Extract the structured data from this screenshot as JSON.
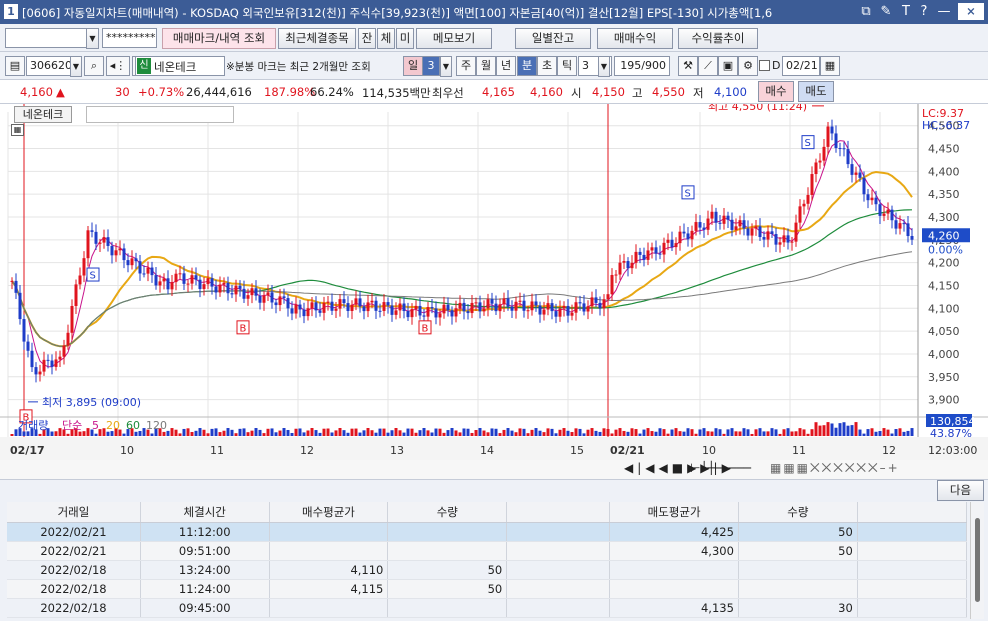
{
  "titlebar": {
    "num": "1",
    "title": "[0606] 자동일지차트(매매내역) - KOSDAQ 외국인보유[312(천)] 주식수[39,923(천)] 액면[100] 자본금[40(억)] 결산[12월] EPS[-130] 시가총액[1,6",
    "icons": [
      "restore-icon",
      "pin-icon",
      "text-icon",
      "help-icon",
      "minimize-icon"
    ],
    "icon_glyphs": [
      "⧉",
      "✎",
      "T",
      "?",
      "—"
    ],
    "winbtn": "×"
  },
  "row1": {
    "account": "",
    "password": "*********",
    "btn_mark": "매매마크/내역 조회",
    "btn_recent": "최근체결종목",
    "btn_jan": "잔",
    "btn_che": "체",
    "btn_mi": "미",
    "btn_memo": "메모보기",
    "btn_daily": "일별잔고",
    "btn_trade": "매매수익",
    "btn_yield": "수익률추이"
  },
  "row2": {
    "code": "306620",
    "badge": "신",
    "name": "네온테크",
    "note": "※분봉 마크는 최근 2개월만 조회",
    "period_il": "일",
    "period_num": "3",
    "period_tabs": [
      "주",
      "월",
      "년",
      "분",
      "초",
      "틱"
    ],
    "period_active": "분",
    "interval": "3",
    "count": "195/900",
    "d_label": "D",
    "date": "02/21"
  },
  "row3": {
    "price": "4,160",
    "arrow": "▲",
    "change": "30",
    "pct": "+0.73%",
    "volume": "26,444,616",
    "vol_ratio": "187.98%",
    "turnover": "66.24%",
    "amount": "114,535백만",
    "best_label": "최우선",
    "best_sell": "4,165",
    "best_buy": "4,160",
    "open_label": "시",
    "open": "4,150",
    "high_label": "고",
    "high": "4,550",
    "low_label": "저",
    "low": "4,100",
    "buy_btn": "매수",
    "sell_btn": "매도"
  },
  "chart": {
    "stock_tab": "네온테크",
    "lc": "LC:9.37",
    "hc": "HC:-6.37",
    "max_label": "최고 4,550 (11:24)",
    "min_label": "최저 3,895 (09:00)",
    "price_ticks": [
      "4,500",
      "4,450",
      "4,400",
      "4,350",
      "4,300",
      "4,250",
      "4,200",
      "4,150",
      "4,100",
      "4,050",
      "4,000",
      "3,950",
      "3,900"
    ],
    "cur_price": "4,260",
    "cur_pct": "0.00%",
    "vol_legend": {
      "label": "거래량",
      "ma": "단순",
      "p1": "5",
      "p2": "20",
      "p3": "60",
      "p4": "120"
    },
    "vol_value": "130,854",
    "vol_pct": "43.87%",
    "x_labels": [
      "02/17",
      "10",
      "11",
      "12",
      "13",
      "14",
      "15",
      "02/21",
      "10",
      "11",
      "12"
    ],
    "time_label": "12:03:00",
    "markers": [
      "B",
      "S",
      "B",
      "B",
      "S",
      "S"
    ],
    "colors": {
      "up": "#e0141e",
      "down": "#1e3cc8",
      "ma5": "#c8148c",
      "ma20": "#e8a814",
      "ma60": "#1e8c3c",
      "ma120": "#7a7a7a"
    }
  },
  "table": {
    "next_btn": "다음",
    "headers": [
      "거래일",
      "체결시간",
      "매수평균가",
      "수량",
      "",
      "매도평균가",
      "수량",
      ""
    ],
    "rows": [
      [
        "2022/02/21",
        "11:12:00",
        "",
        "",
        "",
        "4,425",
        "50",
        ""
      ],
      [
        "2022/02/21",
        "09:51:00",
        "",
        "",
        "",
        "4,300",
        "50",
        ""
      ],
      [
        "2022/02/18",
        "13:24:00",
        "4,110",
        "50",
        "",
        "",
        "",
        ""
      ],
      [
        "2022/02/18",
        "11:24:00",
        "4,115",
        "50",
        "",
        "",
        "",
        ""
      ],
      [
        "2022/02/18",
        "09:45:00",
        "",
        "",
        "",
        "4,135",
        "30",
        ""
      ]
    ]
  }
}
